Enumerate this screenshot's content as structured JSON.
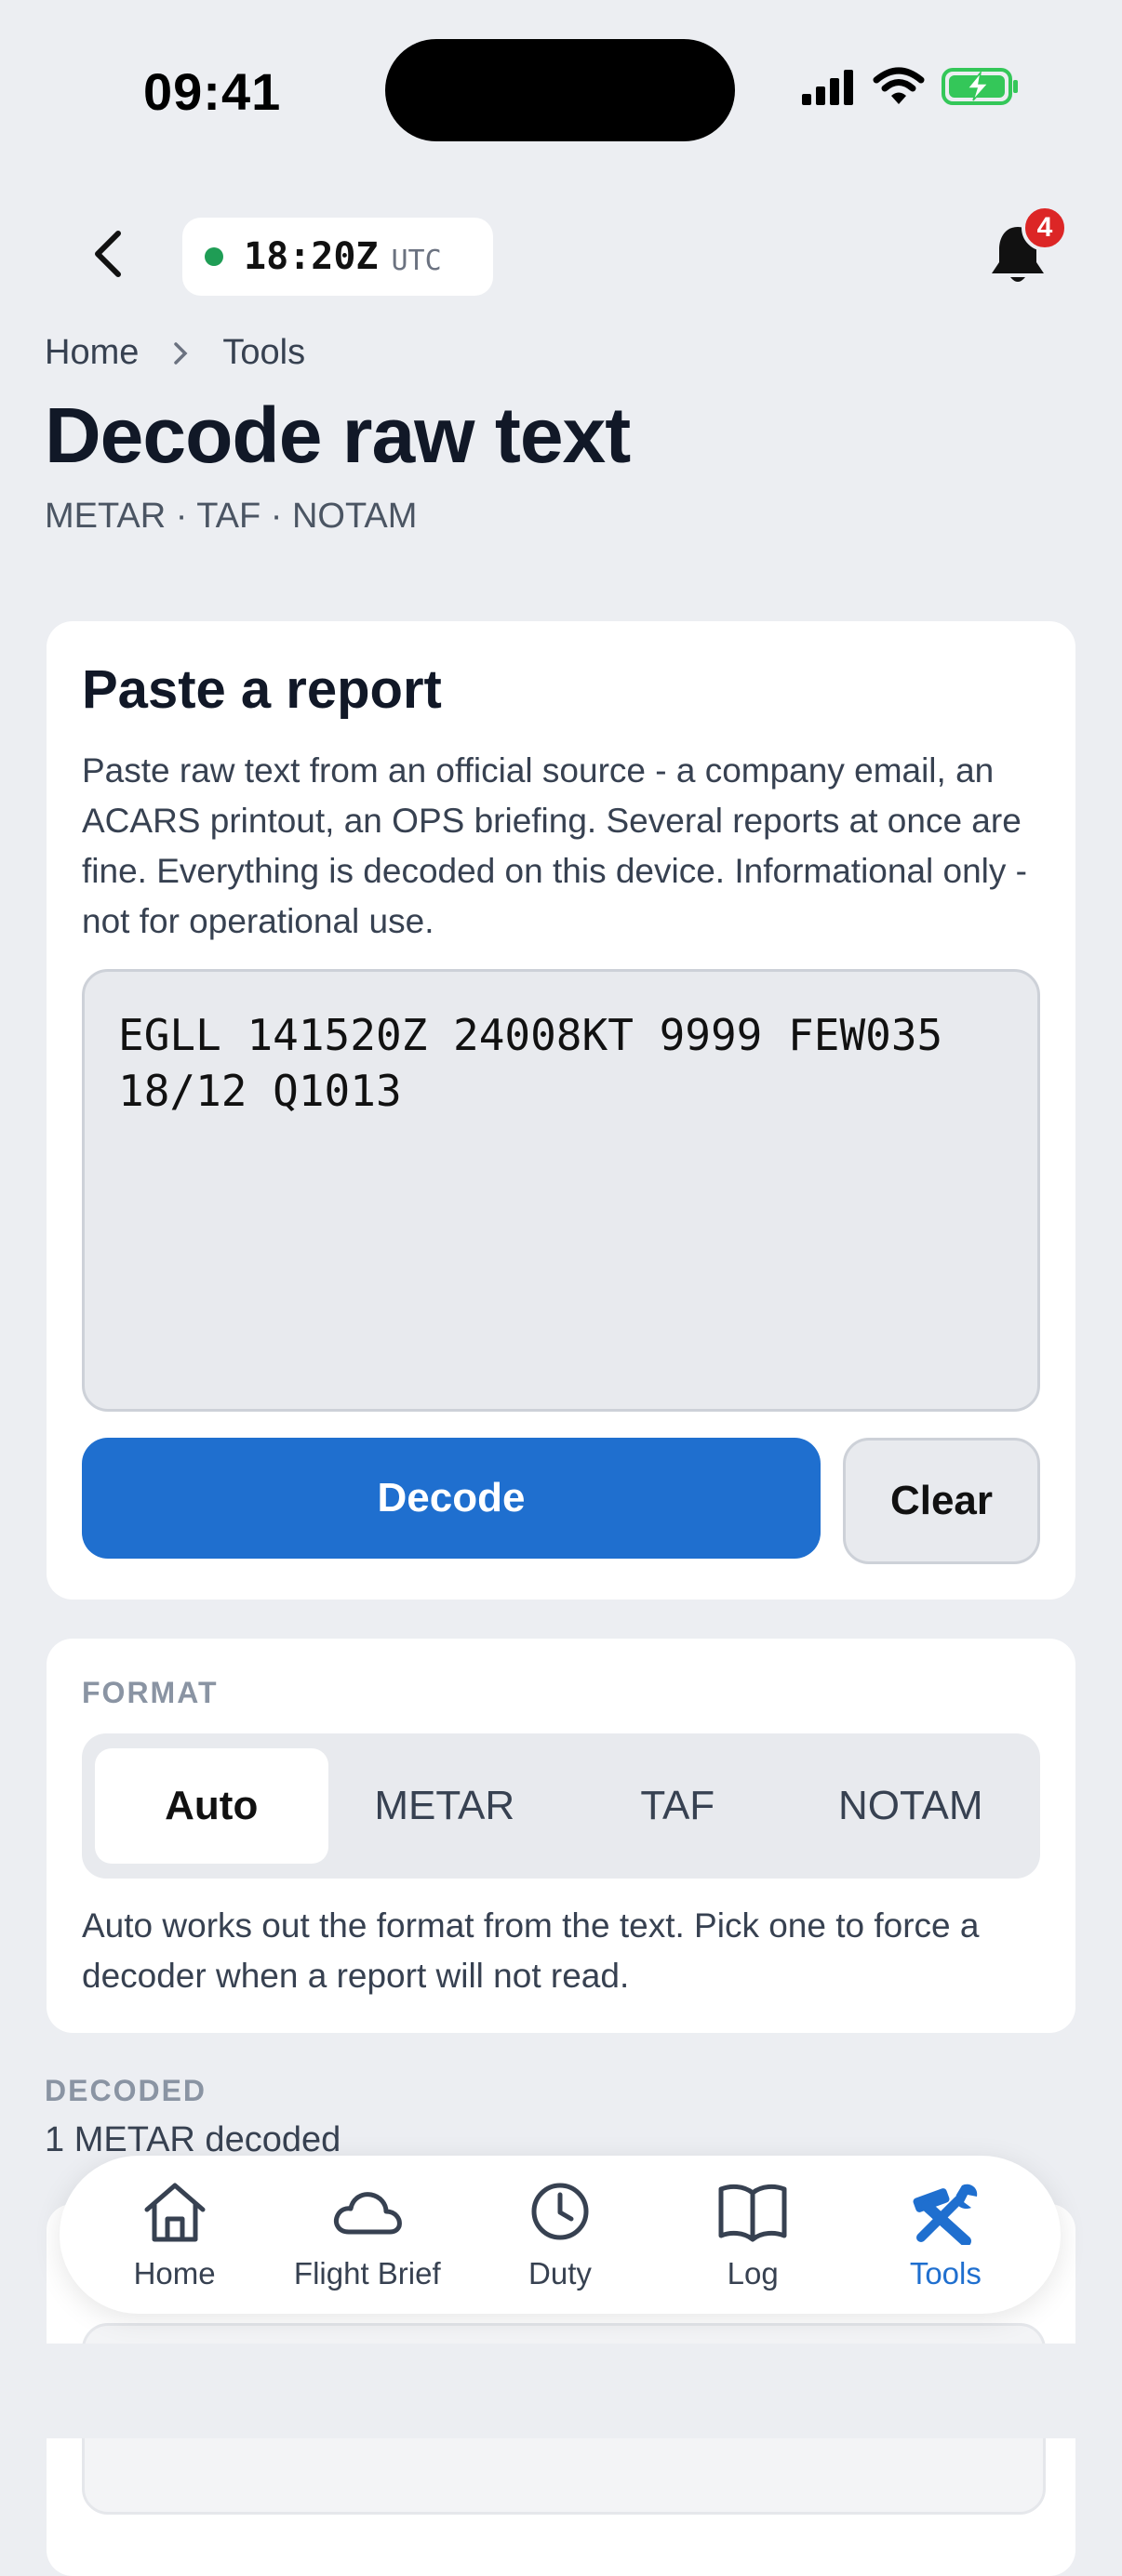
{
  "status_bar": {
    "time": "09:41"
  },
  "header": {
    "utc_time": "18:20Z",
    "utc_label": "UTC",
    "notifications_count": "4"
  },
  "breadcrumb": {
    "home": "Home",
    "tools": "Tools"
  },
  "page": {
    "title": "Decode raw text",
    "subtitle": "METAR · TAF · NOTAM"
  },
  "paste_card": {
    "title": "Paste a report",
    "description": "Paste raw text from an official source - a company email, an ACARS printout, an OPS briefing. Several reports at once are fine. Everything is decoded on this device. Informational only - not for operational use.",
    "raw_text": "EGLL 141520Z 24008KT 9999 FEW035 18/12 Q1013",
    "decode_label": "Decode",
    "clear_label": "Clear"
  },
  "format_card": {
    "label": "FORMAT",
    "options": [
      "Auto",
      "METAR",
      "TAF",
      "NOTAM"
    ],
    "selected": "Auto",
    "hint": "Auto works out the format from the text. Pick one to force a decoder when a report will not read."
  },
  "decoded": {
    "label": "DECODED",
    "count_text": "1 METAR decoded"
  },
  "tabbar": {
    "items": [
      {
        "label": "Home",
        "icon": "home-icon"
      },
      {
        "label": "Flight Brief",
        "icon": "cloud-icon"
      },
      {
        "label": "Duty",
        "icon": "clock-icon"
      },
      {
        "label": "Log",
        "icon": "book-icon"
      },
      {
        "label": "Tools",
        "icon": "tools-icon"
      }
    ],
    "active": "Tools"
  },
  "colors": {
    "accent": "#1f6fcf",
    "background": "#eceef2",
    "badge": "#dc2626",
    "live_dot": "#1f9d55"
  }
}
